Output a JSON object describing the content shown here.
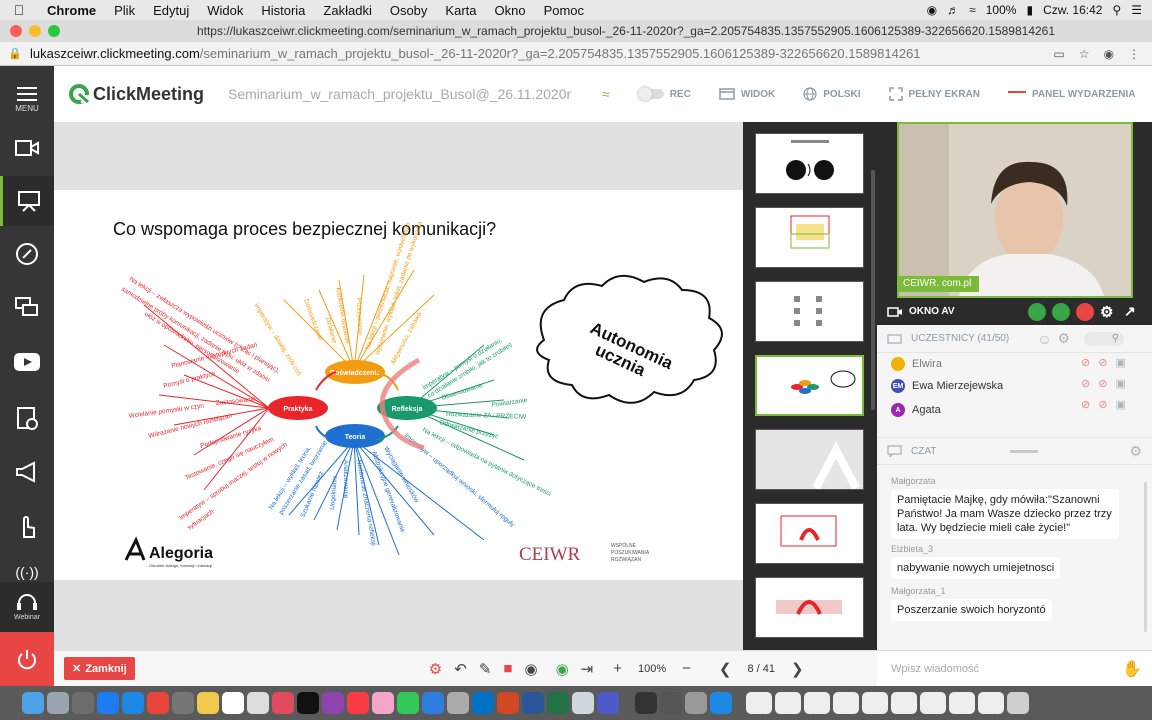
{
  "menubar": {
    "app": "Chrome",
    "items": [
      "Plik",
      "Edytuj",
      "Widok",
      "Historia",
      "Zakładki",
      "Osoby",
      "Karta",
      "Okno",
      "Pomoc"
    ],
    "battery": "100%",
    "clock": "Czw. 16:42"
  },
  "browser": {
    "tab_title": "https://lukaszceiwr.clickmeeting.com/seminarium_w_ramach_projektu_busol-_26-11-2020r?_ga=2.205754835.1357552905.1606125389-322656620.1589814261",
    "url_host": "lukaszceiwr.clickmeeting.com",
    "url_path": "/seminarium_w_ramach_projektu_busol-_26-11-2020r?_ga=2.205754835.1357552905.1606125389-322656620.1589814261"
  },
  "sidebar": {
    "menu_label": "MENU",
    "webinar_label": "Webinar"
  },
  "header": {
    "brand": "ClickMeeting",
    "event_title": "Seminarium_w_ramach_projektu_Busol@_26.11.2020r",
    "rec_label": "REC",
    "view_label": "WIDOK",
    "language_label": "POLSKI",
    "fullscreen_label": "PEŁNY EKRAN",
    "event_panel_label": "PANEL WYDARZENIA"
  },
  "slide": {
    "title": "Co wspomaga proces bezpiecznej komunikacji?",
    "nodes": {
      "experience": "Doświadczenie",
      "practice": "Praktyka",
      "reflection": "Refleksja",
      "theory": "Teoria"
    },
    "cloud": [
      "Autonomia",
      "ucznia"
    ],
    "red_items": [
      "Na lekcji – zwłaszcza wypowiedzi uczniów (chcąc i planując),",
      "samodzielne próby komunikacji, zadanie typu: ułóż w zdaniu",
      "ułóż w opowiadaniu, personalizowanie",
      "Planowanie następnych zadań",
      "Pomyśl o praktyce",
      "Zastosowanie",
      "Wcielanie pomysłu w czyn",
      "Podejmowanie ryzyka",
      "Wdrażanie nowych rozwiązań",
      "Testowanie, czego się nauczyłem",
      "Imperatyw – sprobuj inaczej, testuj w nowych",
      "sytuacjach"
    ],
    "orange_items": [
      "Imperatyw – działaj, zrób coś",
      "Doświadczanie",
      "Działanie",
      "Konkretne działanie",
      "Przeżywanie",
      "Na lekcji – prezentacja, nagranie, wysłuchanie",
      "wykonanie, wykład, tekst, zadanie do wykonania",
      "Aktywności, zabawa"
    ],
    "green_items": [
      "Imperatyw – pomyśl o działaniu,",
      "co działanie zrobiło, jak to zrobiłeś",
      "Obserwowanie",
      "Powtarzanie",
      "Rozważanie ZA i PRZECIW",
      "Odtwarzanie przeżyć",
      "Na lekcji – odpowiada na pytania dotyczące treści"
    ],
    "blue_items": [
      "Na lekcji – wykład, teoria,",
      "poszerzanie zasad, tworzenie",
      "Szukanie hipotez",
      "Uogólnianie",
      "Analizowanie",
      "Nadawanie znaczenia refleksji",
      "Abstrakcyjne generalizowanie",
      "Wyciąganie wniosków",
      "Imperatyw – uporządkuj wnioski, sformułuj reguły"
    ],
    "logo_left": "Alegoria",
    "logo_left_sub": "Ośrodek dialogu, formacji i edukacji",
    "logo_right": "CEIWR",
    "logo_right_sub": [
      "WSPÓLNE",
      "POSZUKIWANIA",
      "ROZWIĄZAŃ"
    ]
  },
  "video": {
    "owner_label": "CEIWR. com.pl",
    "window_label": "OKNO AV"
  },
  "participants": {
    "header": "UCZESTNICY (41/50)",
    "list": [
      {
        "name": "Elwira",
        "initials": "",
        "color": "#f2b100"
      },
      {
        "name": "Ewa Mierzejewska",
        "initials": "EM",
        "color": "#3f51b5"
      },
      {
        "name": "Agata",
        "initials": "A",
        "color": "#9c27b0"
      }
    ]
  },
  "chat": {
    "header": "CZAT",
    "messages": [
      {
        "author": "Małgorzata",
        "text": "Pamiętacie Majkę, gdy mówiła:\"Szanowni Państwo! Ja mam Wasze dziecko przez trzy lata. Wy będziecie mieli całe życie!\""
      },
      {
        "author": "Elżbieta_3",
        "text": "nabywanie nowych umiejetnosci"
      },
      {
        "author": "Małgorzata_1",
        "text": "Poszerzanie swoich horyzontó"
      }
    ],
    "input_placeholder": "Wpisz wiadomość"
  },
  "toolbar": {
    "close_label": "Zamknij",
    "zoom": "100%",
    "page": "8 / 41"
  },
  "colors": {
    "accent_green": "#7cbb3a",
    "close_red": "#e84545",
    "node_red": "#e8262a",
    "node_orange": "#f39c12",
    "node_green": "#1a9a6a",
    "node_blue": "#1f6fd0"
  }
}
